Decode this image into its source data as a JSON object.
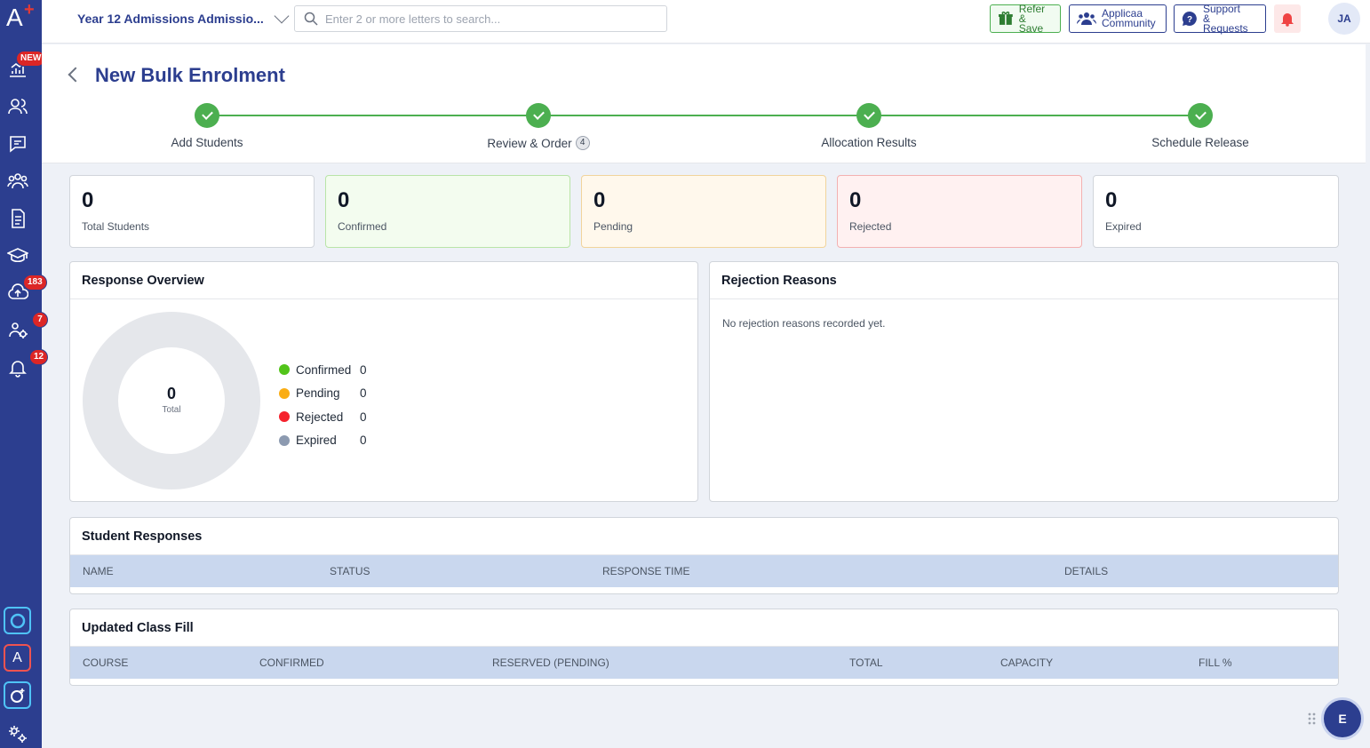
{
  "sidebar": {
    "logo_text": "A",
    "logo_mark": "+",
    "new_badge": "NEW",
    "badges": {
      "uploads": "183",
      "groups": "7",
      "notifications": "12"
    },
    "app_tile_a": "A"
  },
  "topbar": {
    "school_name": "Year 12 Admissions Admissio...",
    "search_placeholder": "Enter 2 or more letters to search...",
    "refer_line1": "Refer",
    "refer_line2": "& Save",
    "community_line1": "Applicaa",
    "community_line2": "Community",
    "support_line1": "Support",
    "support_line2": "& Requests",
    "user_initials": "JA"
  },
  "page": {
    "title": "New Bulk Enrolment"
  },
  "steps": [
    {
      "label": "Add Students"
    },
    {
      "label": "Review & Order",
      "count": "4"
    },
    {
      "label": "Allocation Results"
    },
    {
      "label": "Schedule Release"
    }
  ],
  "stats": [
    {
      "value": "0",
      "label": "Total Students"
    },
    {
      "value": "0",
      "label": "Confirmed"
    },
    {
      "value": "0",
      "label": "Pending"
    },
    {
      "value": "0",
      "label": "Rejected"
    },
    {
      "value": "0",
      "label": "Expired"
    }
  ],
  "response_overview": {
    "title": "Response Overview",
    "total_value": "0",
    "total_label": "Total",
    "legend": [
      {
        "label": "Confirmed",
        "value": "0",
        "color": "#52c41a"
      },
      {
        "label": "Pending",
        "value": "0",
        "color": "#faad14"
      },
      {
        "label": "Rejected",
        "value": "0",
        "color": "#f5222d"
      },
      {
        "label": "Expired",
        "value": "0",
        "color": "#8c9ab0"
      }
    ]
  },
  "rejection_reasons": {
    "title": "Rejection Reasons",
    "empty_text": "No rejection reasons recorded yet."
  },
  "student_responses": {
    "title": "Student Responses",
    "columns": [
      "NAME",
      "STATUS",
      "RESPONSE TIME",
      "DETAILS"
    ]
  },
  "class_fill": {
    "title": "Updated Class Fill",
    "columns": [
      "COURSE",
      "CONFIRMED",
      "RESERVED (PENDING)",
      "TOTAL",
      "CAPACITY",
      "FILL %"
    ]
  },
  "chat": {
    "initial": "E"
  },
  "colors": {
    "brand": "#2c3e8f",
    "success": "#4caf50",
    "header_row": "#c9d7ee"
  }
}
